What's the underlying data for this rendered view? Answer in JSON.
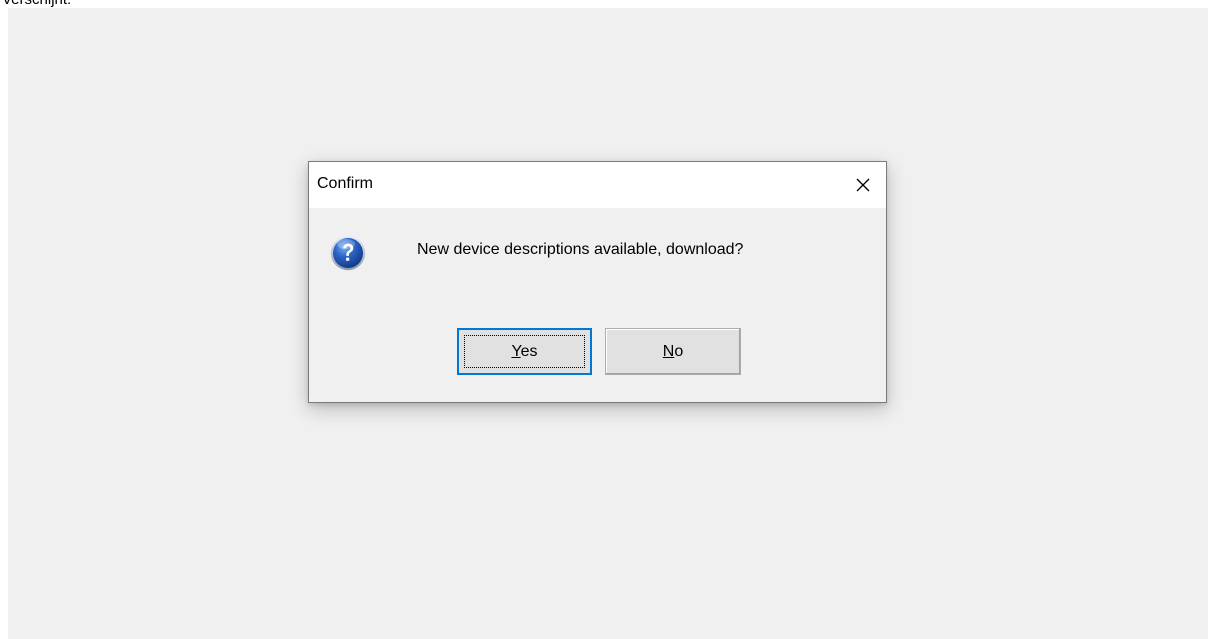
{
  "background_text": "Verschijnt:",
  "dialog": {
    "title": "Confirm",
    "message": "New device descriptions available, download?",
    "icon": "question-icon",
    "buttons": {
      "yes": {
        "accel": "Y",
        "rest": "es"
      },
      "no": {
        "accel": "N",
        "rest": "o"
      }
    }
  },
  "colors": {
    "desktop": "#f0f0f0",
    "titlebar": "#ffffff",
    "focus_border": "#0078d7",
    "button_face": "#e1e1e1",
    "icon_blue": "#1c4fae"
  }
}
